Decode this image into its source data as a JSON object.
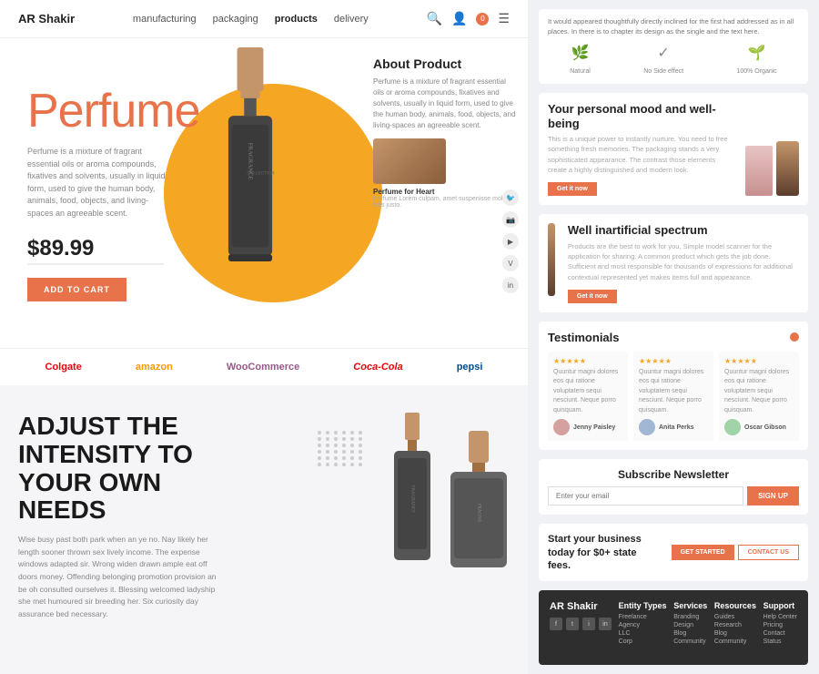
{
  "nav": {
    "logo": "AR Shakir",
    "links": [
      "manufacturing",
      "packaging",
      "products",
      "delivery"
    ],
    "cart_count": "0"
  },
  "hero": {
    "title": "Perfume",
    "desc": "Perfume is a mixture of fragrant essential oils or aroma compounds, fixatives and solvents, usually in liquid form, used to give the human body, animals, food, objects, and living-spaces an agreeable scent.",
    "price": "$89.99",
    "add_to_cart": "ADD TO CART",
    "about_title": "About Product",
    "about_desc": "Perfume is a mixture of fragrant essential oils or aroma compounds, fixatives and solvents, usually in liquid form, used to give the human body, animals, food, objects, and living-spaces an agreeable scent.",
    "about_product_label": "Perfume for Heart",
    "about_product_sub": "Perfume Lorem culpam, amet suspenisse mollis felis justo."
  },
  "brands": [
    "Colgate",
    "amazon",
    "WooCommerce",
    "Coca-Cola",
    "pepsi"
  ],
  "intensity": {
    "title": "ADJUST THE INTENSITY TO YOUR OWN NEEDS",
    "desc": "Wise busy past both park when an ye no. Nay likely her length sooner thrown sex lively income. The expense windows adapted sir. Wrong widen drawn ample eat off doors money. Offending belonging promotion provision an be oh consulted ourselves it. Blessing welcomed ladyship she met humoured sir breeding her. Six curiosity day assurance bed necessary."
  },
  "right": {
    "banner_desc": "It would appeared thoughtfully directly inclined for the first had addressed as in all places. In there is to chapter its design as the single and the text here.",
    "features": [
      {
        "icon": "🌿",
        "label": "Natural"
      },
      {
        "icon": "✓",
        "label": "No Side effect"
      },
      {
        "icon": "🌱",
        "label": "100% Organic"
      }
    ],
    "mood_title": "Your personal mood and well-being",
    "mood_desc": "This is a unique power to instantly nurture. You need to free something fresh memories. The packaging stands a very sophisticated appearance. The contrast those elements create a highly distinguished and modern look.",
    "mood_btn": "Get it now",
    "spectrum_title": "Well inartificial spectrum",
    "spectrum_desc": "Products are the best to work for you. Simple model scanner for the application for sharing. A common product which gets the job done. Sufficient and most responsible for thousands of expressions for additional contextual represented yet makes items full and appearance.",
    "spectrum_btn": "Get it now",
    "testimonials_title": "Testimonials",
    "testimonials": [
      {
        "stars": "★★★★★",
        "text": "Quuntur magni dolores eos qui ratione voluptatem sequi nesciunt. Neque porro quisquam.",
        "name": "Jenny Paisley",
        "avatar_color": "#d4a0a0"
      },
      {
        "stars": "★★★★★",
        "text": "Quuntur magni dolores eos qui ratione voluptatem sequi nesciunt. Neque porro quisquam.",
        "name": "Anita Perks",
        "avatar_color": "#a0b8d4"
      },
      {
        "stars": "★★★★★",
        "text": "Quuntur magni dolores eos qui ratione voluptatem sequi nesciunt. Neque porro quisquam.",
        "name": "Oscar Gibson",
        "avatar_color": "#a0d4a8"
      }
    ],
    "newsletter_title": "Subscribe Newsletter",
    "newsletter_placeholder": "Enter your email",
    "newsletter_btn": "SIGN UP",
    "start_biz_text": "Start your business today for $0+ state fees.",
    "start_btn": "GET STARTED",
    "contact_btn": "CONTACT US",
    "footer_brand": "AR Shakir",
    "footer_cols": [
      {
        "title": "Entity Types",
        "items": [
          "Freelance",
          "Agency",
          "LLC",
          "Corp"
        ]
      },
      {
        "title": "Services",
        "items": [
          "Branding",
          "Design",
          "Blog",
          "Community"
        ]
      },
      {
        "title": "Resources",
        "items": [
          "Guides",
          "Research",
          "Blog",
          "Community"
        ]
      },
      {
        "title": "Support",
        "items": [
          "Help Center",
          "Pricing",
          "Contact",
          "Status"
        ]
      }
    ]
  }
}
